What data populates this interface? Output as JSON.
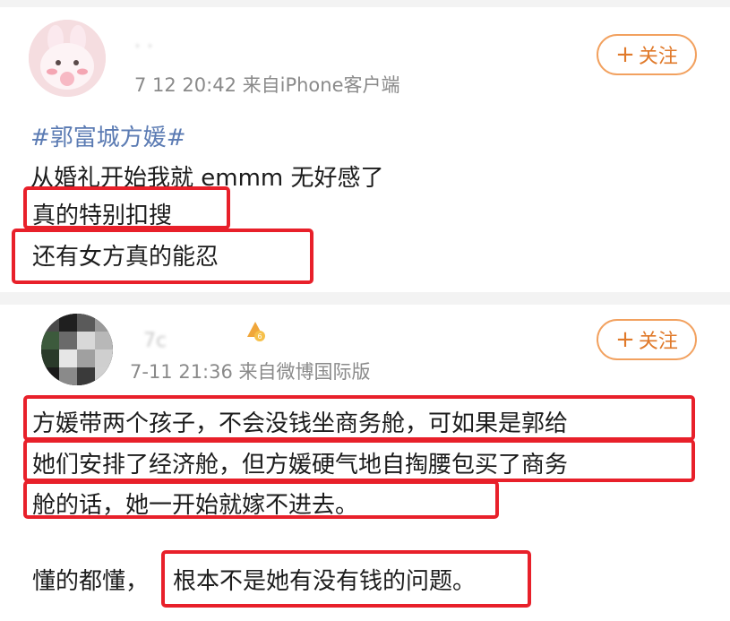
{
  "post1": {
    "username": "· ·",
    "time_source": "7 12 20:42  来自iPhone客户端",
    "follow_label": "关注",
    "follow_plus": "+",
    "hashtag": "#郭富城方媛#",
    "lines": [
      "从婚礼开始我就 emmm 无好感了",
      "真的特别扣搜",
      "还有女方真的能忍"
    ]
  },
  "post2": {
    "username": "7c",
    "time_source": "7-11 21:36  来自微博国际版",
    "follow_label": "关注",
    "follow_plus": "+",
    "lines": [
      "方媛带两个孩子，不会没钱坐商务舱，可如果是郭给",
      "她们安排了经济舱，但方媛硬气地自掏腰包买了商务",
      "舱的话，她一开始就嫁不进去。"
    ],
    "last_prefix": "懂的都懂，",
    "last_boxed": "根本不是她有没有钱的问题。"
  },
  "colors": {
    "highlight": "#e8202a",
    "follow": "#e07a2b",
    "hashtag": "#5b7bb3"
  }
}
